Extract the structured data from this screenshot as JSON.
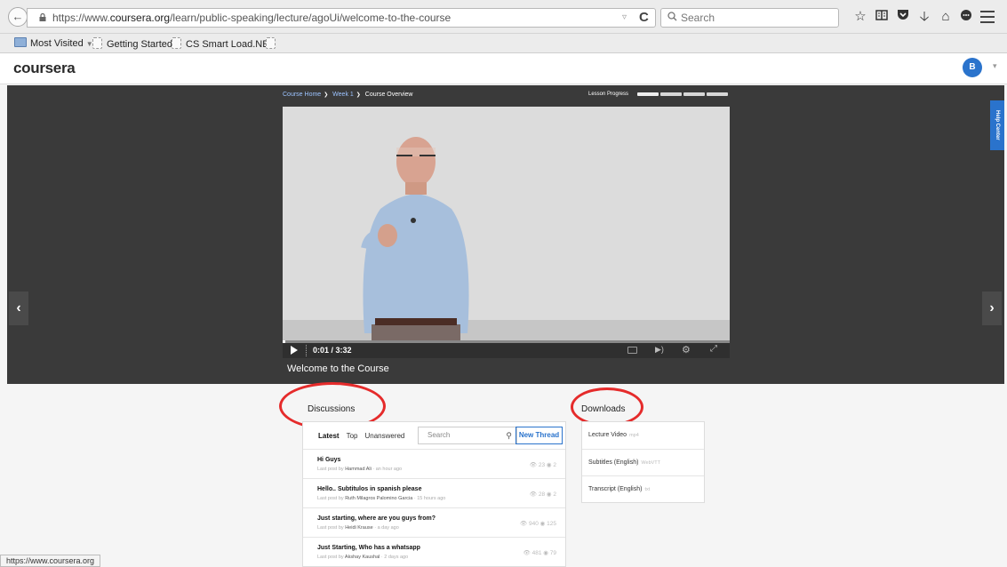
{
  "browser": {
    "url_prefix": "https://www.",
    "url_domain": "coursera.org",
    "url_path": "/learn/public-speaking/lecture/agoUi/welcome-to-the-course",
    "search_placeholder": "Search",
    "bookmarks": [
      "Most Visited",
      "Getting Started",
      "CS Smart Load.NET"
    ],
    "status_url": "https://www.coursera.org"
  },
  "header": {
    "logo": "coursera",
    "avatar_initial": "B"
  },
  "breadcrumb": {
    "items": [
      "Course Home",
      "Week 1",
      "Course Overview"
    ]
  },
  "lesson_progress": {
    "label": "Lesson Progress",
    "segments_total": 4,
    "segments_done": 1
  },
  "player": {
    "current_time": "0:01",
    "duration": "3:32",
    "progress_fraction": 0.005,
    "title": "Welcome to the Course"
  },
  "help_center_label": "Help Center",
  "discussions": {
    "title": "Discussions",
    "tabs": [
      "Latest",
      "Top",
      "Unanswered"
    ],
    "search_placeholder": "Search",
    "new_thread_label": "New Thread",
    "threads": [
      {
        "title": "Hi Guys",
        "meta_prefix": "Last post by",
        "author": "Hammad Ali",
        "when": "· an hour ago",
        "views": "23",
        "replies": "2"
      },
      {
        "title": "Hello.. Subtitulos in spanish please",
        "meta_prefix": "Last post by",
        "author": "Ruth Milagros Palomino Garcia",
        "when": "· 15 hours ago",
        "views": "28",
        "replies": "2"
      },
      {
        "title": "Just starting, where are you guys from?",
        "meta_prefix": "Last post by",
        "author": "Heidi Krause",
        "when": "· a day ago",
        "views": "940",
        "replies": "125"
      },
      {
        "title": "Just Starting, Who has a whatsapp",
        "meta_prefix": "Last post by",
        "author": "Akshay Kaushal",
        "when": "· 2 days ago",
        "views": "481",
        "replies": "79"
      }
    ]
  },
  "downloads": {
    "title": "Downloads",
    "items": [
      {
        "label": "Lecture Video",
        "format": "mp4"
      },
      {
        "label": "Subtitles (English)",
        "format": "WebVTT"
      },
      {
        "label": "Transcript (English)",
        "format": "txt"
      }
    ]
  },
  "colors": {
    "accent": "#2a73cc",
    "annotation": "#e52b2b",
    "stage": "#3a3a3a"
  }
}
